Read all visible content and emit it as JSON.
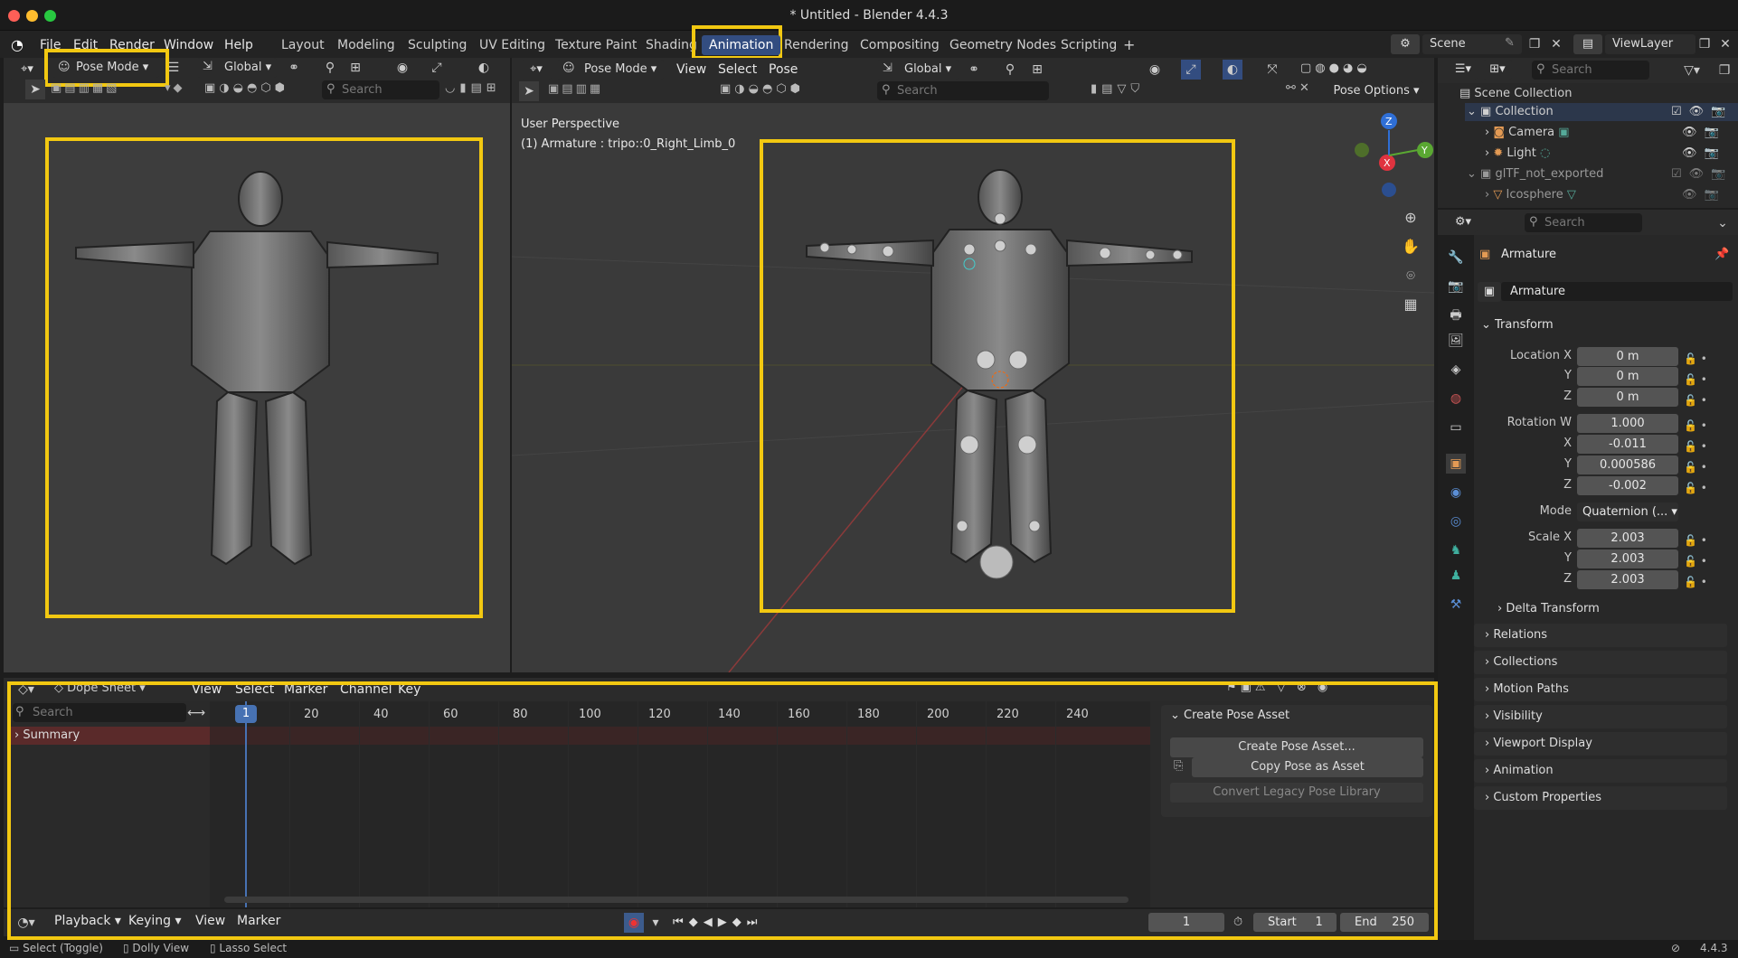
{
  "window": {
    "title": "* Untitled - Blender 4.4.3"
  },
  "menu": [
    "File",
    "Edit",
    "Render",
    "Window",
    "Help"
  ],
  "workspaces": [
    "Layout",
    "Modeling",
    "Sculpting",
    "UV Editing",
    "Texture Paint",
    "Shading",
    "Animation",
    "Rendering",
    "Compositing",
    "Geometry Nodes",
    "Scripting"
  ],
  "scene": {
    "name": "Scene",
    "view_layer": "ViewLayer"
  },
  "left_viewport": {
    "mode": "Pose Mode",
    "orientation": "Global",
    "search_placeholder": "Search"
  },
  "main_viewport": {
    "mode": "Pose Mode",
    "menus": [
      "View",
      "Select",
      "Pose"
    ],
    "orientation": "Global",
    "search_placeholder": "Search",
    "pose_options": "Pose Options",
    "overlay_title": "User Perspective",
    "overlay_object": "(1) Armature : tripo::0_Right_Limb_0",
    "gizmo": {
      "z": "Z",
      "y": "Y",
      "x": "X"
    }
  },
  "outliner": {
    "search_placeholder": "Search",
    "items": [
      {
        "label": "Scene Collection"
      },
      {
        "label": "Collection"
      },
      {
        "label": "Camera"
      },
      {
        "label": "Light"
      },
      {
        "label": "glTF_not_exported"
      },
      {
        "label": "Icosphere"
      }
    ]
  },
  "properties": {
    "search_placeholder": "Search",
    "object_name": "Armature",
    "data_name": "Armature",
    "transform_label": "Transform",
    "location": {
      "label": "Location X",
      "x": "0 m",
      "y_label": "Y",
      "y": "0 m",
      "z_label": "Z",
      "z": "0 m"
    },
    "rotation": {
      "label": "Rotation W",
      "w": "1.000",
      "x_label": "X",
      "x": "-0.011",
      "y_label": "Y",
      "y": "0.000586",
      "z_label": "Z",
      "z": "-0.002"
    },
    "mode": {
      "label": "Mode",
      "value": "Quaternion (..."
    },
    "scale": {
      "label": "Scale X",
      "x": "2.003",
      "y_label": "Y",
      "y": "2.003",
      "z_label": "Z",
      "z": "2.003"
    },
    "delta_transform": "Delta Transform",
    "panels": [
      "Relations",
      "Collections",
      "Motion Paths",
      "Visibility",
      "Viewport Display",
      "Animation",
      "Custom Properties"
    ]
  },
  "dopesheet": {
    "mode": "Dope Sheet",
    "menus": [
      "View",
      "Select",
      "Marker",
      "Channel",
      "Key"
    ],
    "search_placeholder": "Search",
    "summary": "Summary",
    "current_frame": "1",
    "ticks": [
      "20",
      "40",
      "60",
      "80",
      "100",
      "120",
      "140",
      "160",
      "180",
      "200",
      "220",
      "240"
    ],
    "pose_panel": {
      "title": "Create Pose Asset",
      "create": "Create Pose Asset...",
      "copy": "Copy Pose as Asset",
      "convert": "Convert Legacy Pose Library"
    }
  },
  "timeline": {
    "menus": [
      "Playback",
      "Keying",
      "View",
      "Marker"
    ],
    "frame": "1",
    "start_label": "Start",
    "start": "1",
    "end_label": "End",
    "end": "250"
  },
  "statusbar": {
    "items": [
      "Select (Toggle)",
      "Dolly View",
      "Lasso Select"
    ],
    "version": "4.4.3"
  },
  "colors": {
    "accent": "#334d80",
    "highlight": "#f2c811",
    "summary": "#5a2a2a",
    "playhead": "#4772b3"
  }
}
